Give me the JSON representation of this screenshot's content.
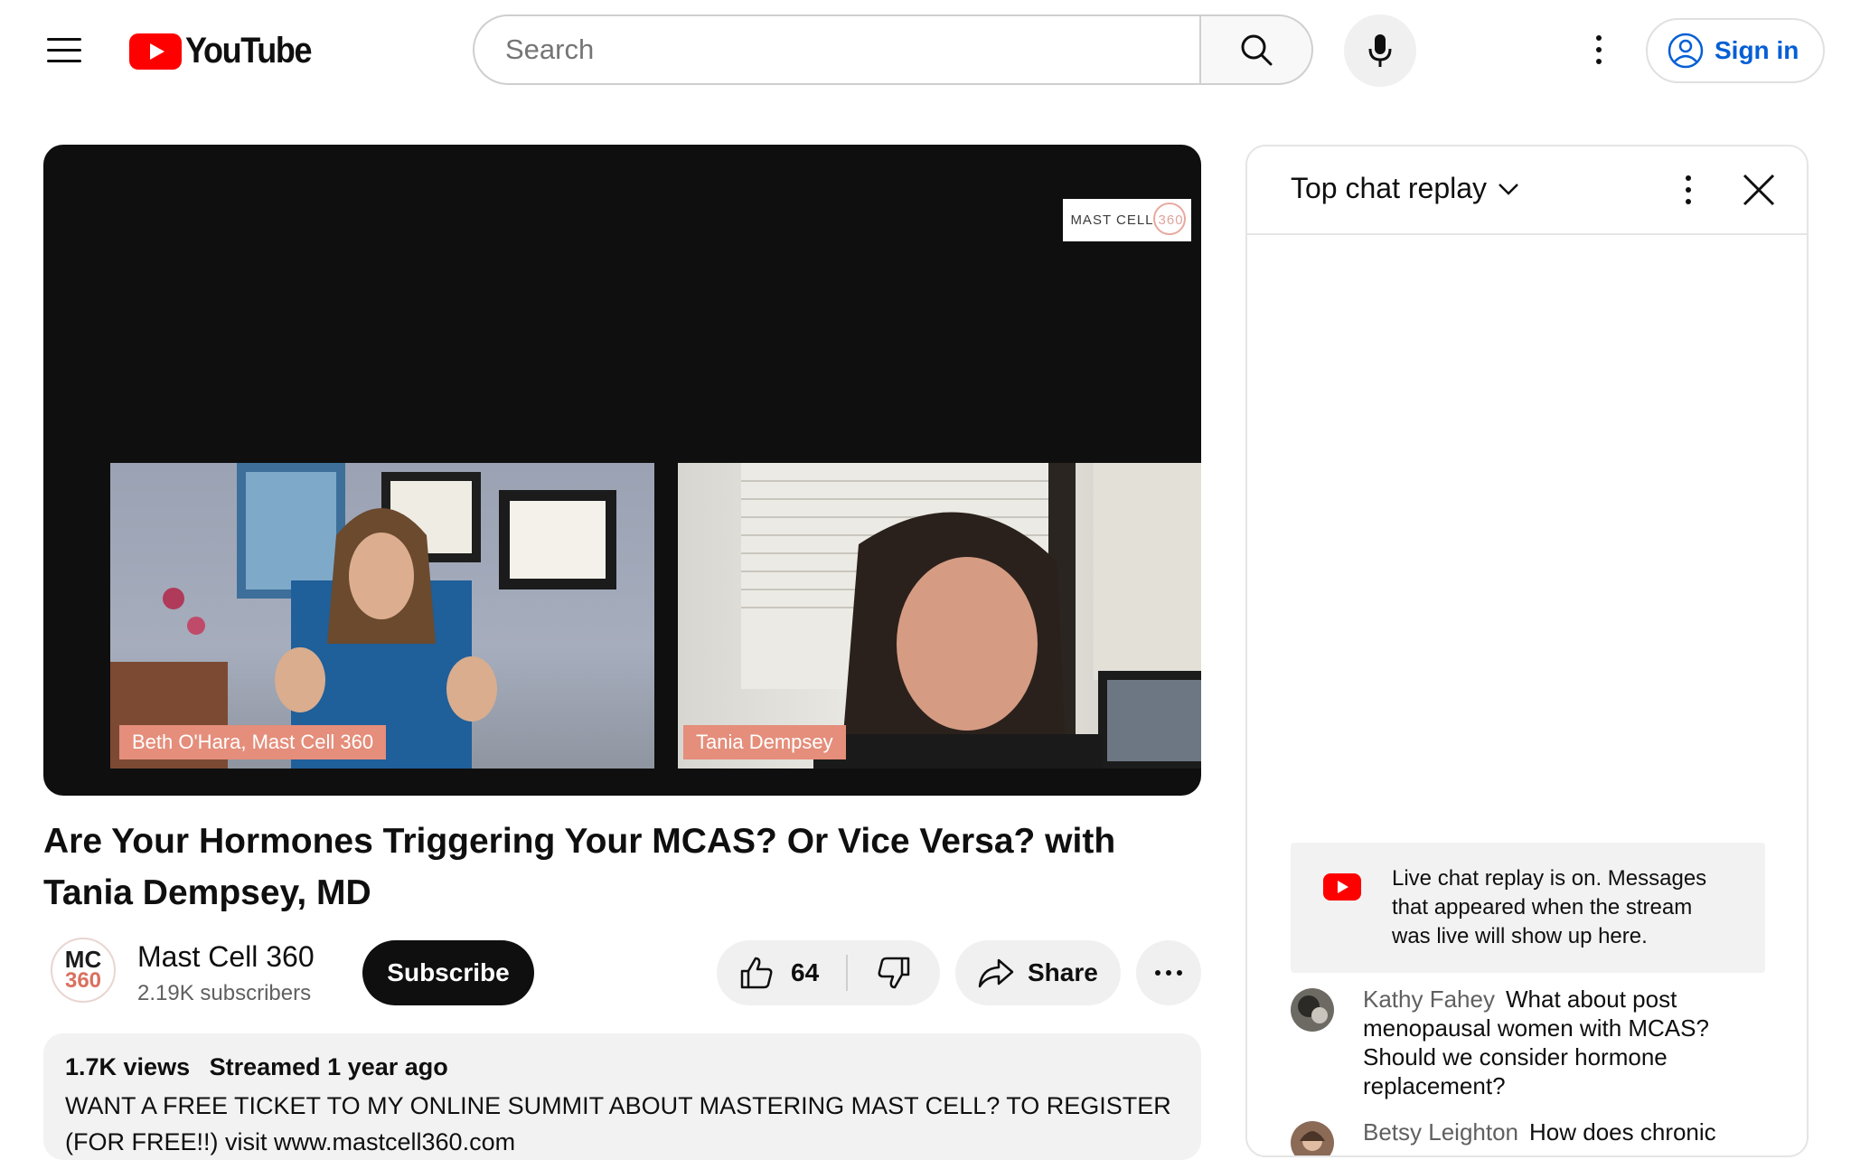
{
  "header": {
    "logo_text": "YouTube",
    "search_placeholder": "Search",
    "sign_in_label": "Sign in"
  },
  "player": {
    "watermark_text": "MAST CELL",
    "watermark_number": "360",
    "left_participant": "Beth O'Hara, Mast Cell 360",
    "right_participant": "Tania Dempsey"
  },
  "video": {
    "title": "Are Your Hormones Triggering Your MCAS? Or Vice Versa? with Tania Dempsey, MD",
    "channel_name": "Mast Cell 360",
    "channel_avatar_top": "MC",
    "channel_avatar_bottom": "360",
    "subscribers": "2.19K subscribers",
    "subscribe_label": "Subscribe",
    "like_count": "64",
    "share_label": "Share"
  },
  "description": {
    "views": "1.7K views",
    "streamed": "Streamed 1 year ago",
    "text": "WANT A FREE TICKET TO MY ONLINE SUMMIT ABOUT MASTERING MAST CELL?  TO REGISTER (FOR FREE!!) visit www.mastcell360.com"
  },
  "chat": {
    "title": "Top chat replay",
    "notice": "Live chat replay is on. Messages that appeared when the stream was live will show up here.",
    "messages": [
      {
        "author": "Kathy Fahey",
        "text": "What about post menopausal women with MCAS? Should we consider hormone replacement?"
      },
      {
        "author": "Betsy Leighton",
        "text": "How does chronic"
      }
    ]
  },
  "colors": {
    "brand_red": "#ff0000",
    "link_blue": "#065fd4",
    "name_tag": "#e48e7b"
  }
}
